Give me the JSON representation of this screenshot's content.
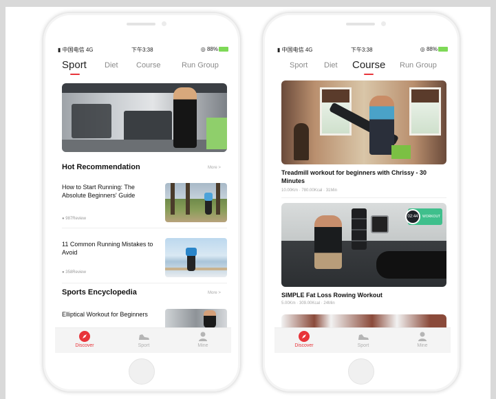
{
  "status": {
    "carrier": "中国电信 4G",
    "time": "下午3:38",
    "battery": "88%"
  },
  "tabs": [
    "Sport",
    "Diet",
    "Course",
    "Run Group"
  ],
  "phone1": {
    "active_tab": "Sport",
    "hot_section": {
      "title": "Hot Recommendation",
      "more": "More >",
      "items": [
        {
          "title": "How to Start Running: The Absolute Beginners' Guide",
          "meta": "987Review"
        },
        {
          "title": "11 Common Running Mistakes to Avoid",
          "meta": "358Review"
        }
      ]
    },
    "encyclopedia_section": {
      "title": "Sports Encyclopedia",
      "more": "More >",
      "items": [
        {
          "title": "Elliptical Workout for Beginners"
        }
      ]
    }
  },
  "phone2": {
    "active_tab": "Course",
    "courses": [
      {
        "title": "Treadmill workout for beginners with Chrissy - 30 Minutes",
        "meta": "10.00Km · 780.00Kcal · 31Min"
      },
      {
        "title": "SIMPLE Fat Loss Rowing Workout",
        "meta": "5.00Km · 309.00Kcal · 24Min",
        "badge_time": "02:44",
        "badge_label": "WORKOUT"
      }
    ]
  },
  "bottom_nav": [
    {
      "label": "Discover",
      "icon": "compass-icon",
      "active": true
    },
    {
      "label": "Sport",
      "icon": "shoe-icon",
      "active": false
    },
    {
      "label": "Mine",
      "icon": "person-icon",
      "active": false
    }
  ],
  "colors": {
    "accent": "#e8343a",
    "badge": "#3fbf8c",
    "battery": "#7ed957"
  }
}
